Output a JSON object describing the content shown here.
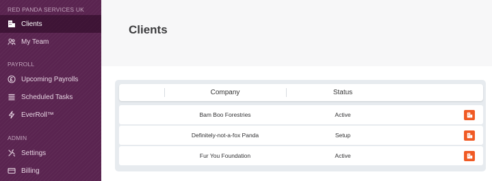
{
  "sidebar": {
    "org_name": "RED PANDA SERVICES UK",
    "sections": [
      {
        "title": "",
        "items": [
          {
            "label": "Clients",
            "icon": "building-icon",
            "active": true
          },
          {
            "label": "My Team",
            "icon": "team-icon",
            "active": false
          }
        ]
      },
      {
        "title": "PAYROLL",
        "items": [
          {
            "label": "Upcoming Payrolls",
            "icon": "currency-icon",
            "active": false
          },
          {
            "label": "Scheduled Tasks",
            "icon": "list-icon",
            "active": false
          },
          {
            "label": "EverRoll™",
            "icon": "bolt-icon",
            "active": false
          }
        ]
      },
      {
        "title": "ADMIN",
        "items": [
          {
            "label": "Settings",
            "icon": "tools-icon",
            "active": false
          },
          {
            "label": "Billing",
            "icon": "card-icon",
            "active": false
          }
        ]
      }
    ]
  },
  "main": {
    "page_title": "Clients",
    "table": {
      "columns": [
        "Company",
        "Status"
      ],
      "rows": [
        {
          "company": "Bam Boo Forestries",
          "status": "Active",
          "action_icon": "building-icon"
        },
        {
          "company": "Definitely-not-a-fox Panda",
          "status": "Setup",
          "action_icon": "building-icon"
        },
        {
          "company": "Fur You Foundation",
          "status": "Active",
          "action_icon": "building-icon"
        }
      ]
    }
  },
  "colors": {
    "sidebar_bg": "#5a2450",
    "accent": "#f05a24"
  }
}
